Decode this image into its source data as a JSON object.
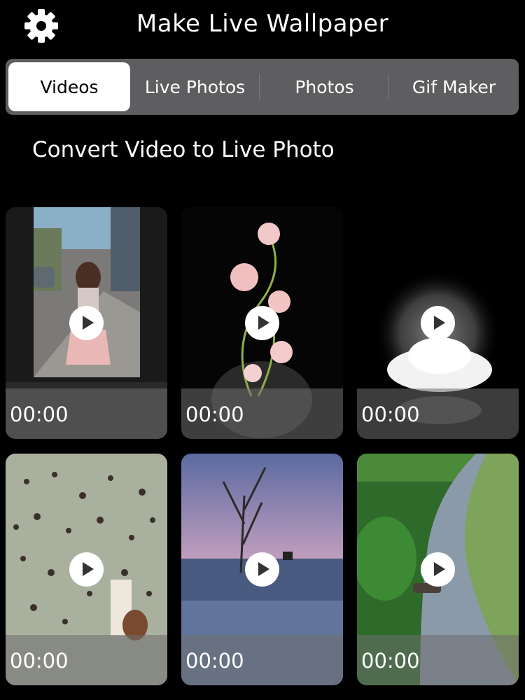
{
  "header": {
    "title": "Make Live Wallpaper"
  },
  "tabs": [
    {
      "label": "Videos",
      "active": true
    },
    {
      "label": "Live Photos",
      "active": false
    },
    {
      "label": "Photos",
      "active": false
    },
    {
      "label": "Gif Maker",
      "active": false
    }
  ],
  "subtitle": "Convert Video to Live Photo",
  "videos": [
    {
      "duration": "00:00",
      "thumb": "girl-on-street"
    },
    {
      "duration": "00:00",
      "thumb": "pink-flowers-in-vase"
    },
    {
      "duration": "00:00",
      "thumb": "white-glowing-flower"
    },
    {
      "duration": "00:00",
      "thumb": "flock-of-birds"
    },
    {
      "duration": "00:00",
      "thumb": "tree-in-sea-sunset"
    },
    {
      "duration": "00:00",
      "thumb": "river-landscape"
    }
  ],
  "colors": {
    "tab_bar": "#5e5e60",
    "active_tab": "#ffffff",
    "background": "#000000"
  }
}
